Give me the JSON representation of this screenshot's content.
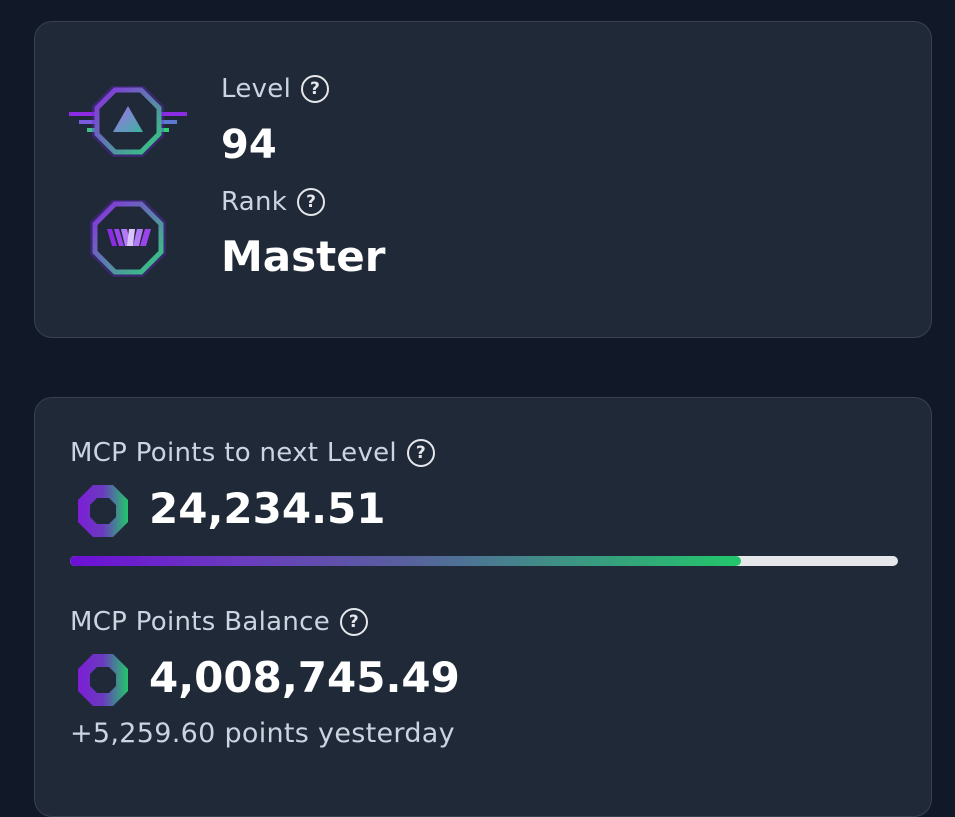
{
  "level": {
    "label": "Level",
    "value": "94",
    "help_icon": "question-circle-icon"
  },
  "rank": {
    "label": "Rank",
    "value": "Master",
    "help_icon": "question-circle-icon"
  },
  "points_to_next": {
    "label": "MCP Points to next Level",
    "value": "24,234.51",
    "progress_fraction": 0.81,
    "help_icon": "question-circle-icon"
  },
  "balance": {
    "label": "MCP Points Balance",
    "value": "4,008,745.49",
    "yesterday": "+5,259.60 points yesterday",
    "help_icon": "question-circle-icon"
  },
  "help_glyph": "?",
  "colors": {
    "background": "#111827",
    "card": "#1f2937",
    "purple": "#7c1ed6",
    "green": "#22c76a"
  }
}
